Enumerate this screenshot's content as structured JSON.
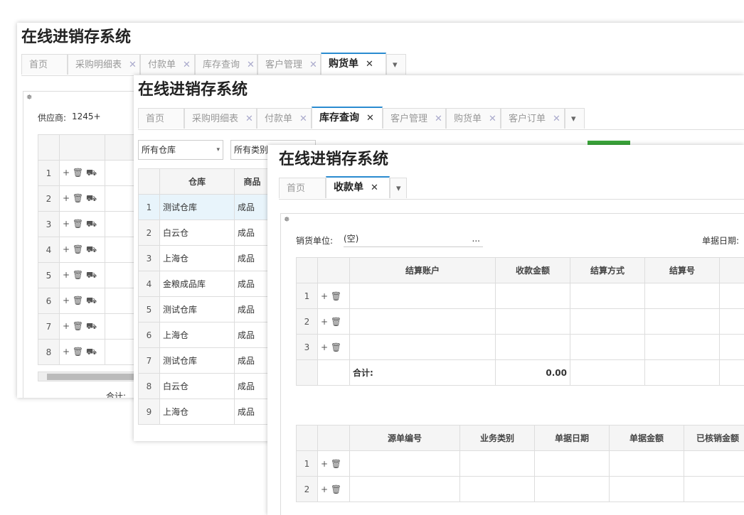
{
  "app_title": "在线进销存系统",
  "win1": {
    "tabs": [
      {
        "label": "首页",
        "closable": false
      },
      {
        "label": "采购明细表",
        "closable": true
      },
      {
        "label": "付款单",
        "closable": true
      },
      {
        "label": "库存查询",
        "closable": true
      },
      {
        "label": "客户管理",
        "closable": true
      },
      {
        "label": "购货单",
        "closable": true,
        "active": true
      }
    ],
    "supplier_label": "供应商:",
    "supplier_value": "1245+",
    "row_numbers": [
      "1",
      "2",
      "3",
      "4",
      "5",
      "6",
      "7",
      "8"
    ],
    "total_label": "合计:"
  },
  "win2": {
    "tabs": [
      {
        "label": "首页",
        "closable": false
      },
      {
        "label": "采购明细表",
        "closable": true
      },
      {
        "label": "付款单",
        "closable": true
      },
      {
        "label": "库存查询",
        "closable": true,
        "active": true
      },
      {
        "label": "客户管理",
        "closable": true
      },
      {
        "label": "购货单",
        "closable": true
      },
      {
        "label": "客户订单",
        "closable": true
      }
    ],
    "warehouse_filter": "所有仓库",
    "category_filter": "所有类别",
    "columns": [
      "仓库",
      "商品"
    ],
    "rows": [
      {
        "n": "1",
        "warehouse": "测试仓库",
        "goods": "成品"
      },
      {
        "n": "2",
        "warehouse": "白云仓",
        "goods": "成品"
      },
      {
        "n": "3",
        "warehouse": "上海仓",
        "goods": "成品"
      },
      {
        "n": "4",
        "warehouse": "金粮成品库",
        "goods": "成品"
      },
      {
        "n": "5",
        "warehouse": "测试仓库",
        "goods": "成品"
      },
      {
        "n": "6",
        "warehouse": "上海仓",
        "goods": "成品"
      },
      {
        "n": "7",
        "warehouse": "测试仓库",
        "goods": "成品"
      },
      {
        "n": "8",
        "warehouse": "白云仓",
        "goods": "成品"
      },
      {
        "n": "9",
        "warehouse": "上海仓",
        "goods": "成品"
      }
    ]
  },
  "win3": {
    "tabs": [
      {
        "label": "首页",
        "closable": false
      },
      {
        "label": "收款单",
        "closable": true,
        "active": true
      }
    ],
    "sales_unit_label": "销货单位:",
    "sales_unit_value": "(空)",
    "sales_unit_more": "...",
    "date_label": "单据日期:",
    "table1": {
      "columns": [
        "结算账户",
        "收款金额",
        "结算方式",
        "结算号"
      ],
      "row_numbers": [
        "1",
        "2",
        "3"
      ],
      "total_label": "合计:",
      "total_amount": "0.00"
    },
    "table2": {
      "columns": [
        "源单编号",
        "业务类别",
        "单据日期",
        "单据金额",
        "已核销金额"
      ],
      "row_numbers": [
        "1",
        "2"
      ]
    }
  },
  "icons": {
    "close": "close-icon",
    "dropdown": "caret-down-icon",
    "gear": "gear-icon",
    "add": "plus-icon",
    "delete": "trash-icon",
    "cart": "cart-icon"
  },
  "colors": {
    "accent": "#2a8bd0",
    "green": "#3aa53a",
    "header_bg": "#f5f5f5"
  }
}
